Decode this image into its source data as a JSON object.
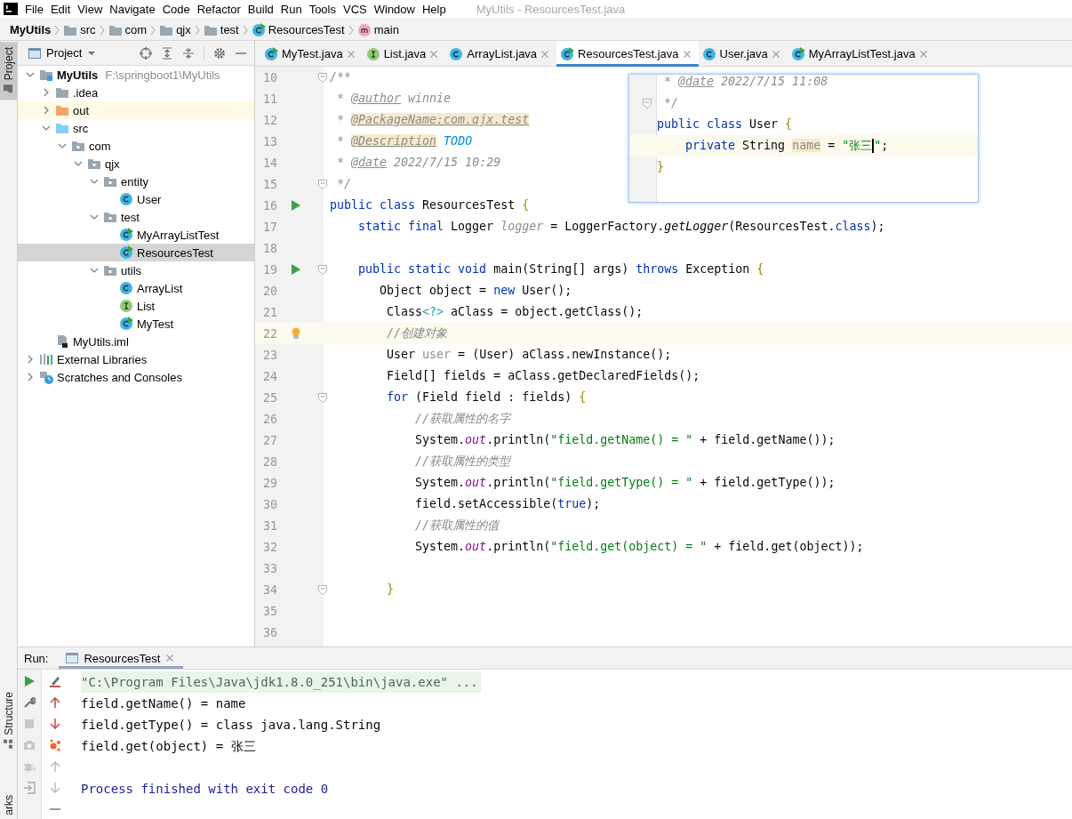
{
  "menu_bar": {
    "items": [
      "File",
      "Edit",
      "View",
      "Navigate",
      "Code",
      "Refactor",
      "Build",
      "Run",
      "Tools",
      "VCS",
      "Window",
      "Help"
    ],
    "window_title": "MyUtils - ResourcesTest.java"
  },
  "breadcrumbs": [
    {
      "label": "MyUtils",
      "kind": "project"
    },
    {
      "label": "src",
      "kind": "folder"
    },
    {
      "label": "com",
      "kind": "folder"
    },
    {
      "label": "qjx",
      "kind": "folder"
    },
    {
      "label": "test",
      "kind": "folder"
    },
    {
      "label": "ResourcesTest",
      "kind": "runnable-class"
    },
    {
      "label": "main",
      "kind": "method"
    }
  ],
  "tool_strip": [
    {
      "label": "Project",
      "selected": true,
      "kind": "top"
    },
    {
      "label": "Structure",
      "selected": false,
      "kind": "bottom"
    },
    {
      "label": "arks",
      "selected": false,
      "kind": "cut"
    }
  ],
  "project": {
    "title": "Project",
    "tree": [
      {
        "label": "MyUtils",
        "path": "F:\\springboot1\\MyUtils",
        "kind": "module",
        "expanded": true,
        "selected": false,
        "hovered": false,
        "children": [
          {
            "label": ".idea",
            "kind": "folder",
            "expanded": false,
            "selected": false,
            "hovered": false
          },
          {
            "label": "out",
            "kind": "excluded-folder",
            "expanded": false,
            "selected": false,
            "hovered": true
          },
          {
            "label": "src",
            "kind": "source-folder",
            "expanded": true,
            "selected": false,
            "hovered": false,
            "children": [
              {
                "label": "com",
                "kind": "package",
                "expanded": true,
                "selected": false,
                "hovered": false,
                "children": [
                  {
                    "label": "qjx",
                    "kind": "package",
                    "expanded": true,
                    "selected": false,
                    "hovered": false,
                    "children": [
                      {
                        "label": "entity",
                        "kind": "package",
                        "expanded": true,
                        "selected": false,
                        "hovered": false,
                        "children": [
                          {
                            "label": "User",
                            "kind": "class",
                            "selected": false,
                            "hovered": false
                          }
                        ]
                      },
                      {
                        "label": "test",
                        "kind": "package",
                        "expanded": true,
                        "selected": false,
                        "hovered": false,
                        "children": [
                          {
                            "label": "MyArrayListTest",
                            "kind": "runnable-class",
                            "selected": false,
                            "hovered": false
                          },
                          {
                            "label": "ResourcesTest",
                            "kind": "runnable-class",
                            "selected": true,
                            "hovered": false
                          }
                        ]
                      },
                      {
                        "label": "utils",
                        "kind": "package",
                        "expanded": true,
                        "selected": false,
                        "hovered": false,
                        "children": [
                          {
                            "label": "ArrayList",
                            "kind": "class",
                            "selected": false,
                            "hovered": false
                          },
                          {
                            "label": "List",
                            "kind": "interface",
                            "selected": false,
                            "hovered": false
                          },
                          {
                            "label": "MyTest",
                            "kind": "runnable-class",
                            "selected": false,
                            "hovered": false
                          }
                        ]
                      }
                    ]
                  }
                ]
              }
            ]
          },
          {
            "label": "MyUtils.iml",
            "kind": "iml",
            "selected": false,
            "hovered": false
          }
        ]
      },
      {
        "label": "External Libraries",
        "kind": "libraries",
        "expanded": false,
        "selected": false,
        "hovered": false
      },
      {
        "label": "Scratches and Consoles",
        "kind": "scratches",
        "expanded": false,
        "selected": false,
        "hovered": false
      }
    ]
  },
  "editor_tabs": [
    {
      "label": "MyTest.java",
      "kind": "runnable-class",
      "selected": false
    },
    {
      "label": "List.java",
      "kind": "interface",
      "selected": false
    },
    {
      "label": "ArrayList.java",
      "kind": "class",
      "selected": false
    },
    {
      "label": "ResourcesTest.java",
      "kind": "runnable-class",
      "selected": true
    },
    {
      "label": "User.java",
      "kind": "class",
      "selected": false
    },
    {
      "label": "MyArrayListTest.java",
      "kind": "runnable-class",
      "selected": false
    }
  ],
  "editor": {
    "lines": [
      {
        "number": "10",
        "kind": "plain",
        "fold": true,
        "current": false,
        "tokens": [
          {
            "kind": "doc",
            "text": "/**"
          }
        ]
      },
      {
        "number": "11",
        "kind": "plain",
        "fold": false,
        "current": false,
        "tokens": [
          {
            "kind": "doc",
            "text": " * "
          },
          {
            "kind": "doctag",
            "text": "@author"
          },
          {
            "kind": "doc",
            "text": " winnie"
          }
        ]
      },
      {
        "number": "12",
        "kind": "plain",
        "fold": false,
        "current": false,
        "tokens": [
          {
            "kind": "doc",
            "text": " * "
          },
          {
            "kind": "doctag-marked",
            "text": "@PackageName:com.qjx.test"
          }
        ]
      },
      {
        "number": "13",
        "kind": "plain",
        "fold": false,
        "current": false,
        "tokens": [
          {
            "kind": "doc",
            "text": " * "
          },
          {
            "kind": "doctag-marked",
            "text": "@Description"
          },
          {
            "kind": "todo",
            "text": " TODO"
          }
        ]
      },
      {
        "number": "14",
        "kind": "plain",
        "fold": false,
        "current": false,
        "tokens": [
          {
            "kind": "doc",
            "text": " * "
          },
          {
            "kind": "doctag",
            "text": "@date"
          },
          {
            "kind": "doc",
            "text": " 2022/7/15 10:29"
          }
        ]
      },
      {
        "number": "15",
        "kind": "plain",
        "fold": true,
        "current": false,
        "tokens": [
          {
            "kind": "doc",
            "text": " */"
          }
        ]
      },
      {
        "number": "16",
        "kind": "run",
        "fold": false,
        "current": false,
        "tokens": [
          {
            "kind": "kw",
            "text": "public class "
          },
          {
            "kind": "plain",
            "text": "ResourcesTest "
          },
          {
            "kind": "brace",
            "text": "{"
          }
        ]
      },
      {
        "number": "17",
        "kind": "plain",
        "fold": false,
        "current": false,
        "tokens": [
          {
            "kind": "kw",
            "text": "    static final "
          },
          {
            "kind": "plain",
            "text": "Logger "
          },
          {
            "kind": "unused-static",
            "text": "logger"
          },
          {
            "kind": "plain",
            "text": " = LoggerFactory."
          },
          {
            "kind": "static-call",
            "text": "getLogger"
          },
          {
            "kind": "plain",
            "text": "(ResourcesTest."
          },
          {
            "kind": "kw",
            "text": "class"
          },
          {
            "kind": "plain",
            "text": ");"
          }
        ]
      },
      {
        "number": "18",
        "kind": "plain",
        "fold": false,
        "current": false
      },
      {
        "number": "19",
        "kind": "run",
        "fold": true,
        "current": false,
        "tokens": [
          {
            "kind": "kw",
            "text": "    public static void "
          },
          {
            "kind": "plain",
            "text": "main(String[] args) "
          },
          {
            "kind": "kw",
            "text": "throws "
          },
          {
            "kind": "plain",
            "text": "Exception "
          },
          {
            "kind": "brace",
            "text": "{"
          }
        ]
      },
      {
        "number": "20",
        "kind": "plain",
        "fold": false,
        "current": false,
        "tokens": [
          {
            "kind": "plain",
            "text": "       Object object = "
          },
          {
            "kind": "kw",
            "text": "new "
          },
          {
            "kind": "plain",
            "text": "User();"
          }
        ]
      },
      {
        "number": "21",
        "kind": "plain",
        "fold": false,
        "current": false,
        "tokens": [
          {
            "kind": "plain",
            "text": "        Class"
          },
          {
            "kind": "generic",
            "text": "<?>"
          },
          {
            "kind": "plain",
            "text": " aClass = object.getClass();"
          }
        ]
      },
      {
        "number": "22",
        "kind": "bulb",
        "fold": false,
        "current": true,
        "tokens": [
          {
            "kind": "comment",
            "text": "        //创建对象"
          }
        ]
      },
      {
        "number": "23",
        "kind": "plain",
        "fold": false,
        "current": false,
        "tokens": [
          {
            "kind": "plain",
            "text": "        User "
          },
          {
            "kind": "unused",
            "text": "user"
          },
          {
            "kind": "plain",
            "text": " = (User) aClass.newInstance();"
          }
        ]
      },
      {
        "number": "24",
        "kind": "plain",
        "fold": false,
        "current": false,
        "tokens": [
          {
            "kind": "plain",
            "text": "        Field[] fields = aClass.getDeclaredFields();"
          }
        ]
      },
      {
        "number": "25",
        "kind": "plain",
        "fold": true,
        "current": false,
        "tokens": [
          {
            "kind": "kw",
            "text": "        for "
          },
          {
            "kind": "plain",
            "text": "(Field field : fields) "
          },
          {
            "kind": "brace",
            "text": "{"
          }
        ]
      },
      {
        "number": "26",
        "kind": "plain",
        "fold": false,
        "current": false,
        "tokens": [
          {
            "kind": "comment",
            "text": "            //获取属性的名字"
          }
        ]
      },
      {
        "number": "27",
        "kind": "plain",
        "fold": false,
        "current": false,
        "tokens": [
          {
            "kind": "plain",
            "text": "            System."
          },
          {
            "kind": "static",
            "text": "out"
          },
          {
            "kind": "plain",
            "text": ".println("
          },
          {
            "kind": "string",
            "text": "\"field.getName() = \""
          },
          {
            "kind": "plain",
            "text": " + field.getName());"
          }
        ]
      },
      {
        "number": "28",
        "kind": "plain",
        "fold": false,
        "current": false,
        "tokens": [
          {
            "kind": "comment",
            "text": "            //获取属性的类型"
          }
        ]
      },
      {
        "number": "29",
        "kind": "plain",
        "fold": false,
        "current": false,
        "tokens": [
          {
            "kind": "plain",
            "text": "            System."
          },
          {
            "kind": "static",
            "text": "out"
          },
          {
            "kind": "plain",
            "text": ".println("
          },
          {
            "kind": "string",
            "text": "\"field.getType() = \""
          },
          {
            "kind": "plain",
            "text": " + field.getType());"
          }
        ]
      },
      {
        "number": "30",
        "kind": "plain",
        "fold": false,
        "current": false,
        "tokens": [
          {
            "kind": "plain",
            "text": "            field.setAccessible("
          },
          {
            "kind": "kw",
            "text": "true"
          },
          {
            "kind": "plain",
            "text": ");"
          }
        ]
      },
      {
        "number": "31",
        "kind": "plain",
        "fold": false,
        "current": false,
        "tokens": [
          {
            "kind": "comment",
            "text": "            //获取属性的值"
          }
        ]
      },
      {
        "number": "32",
        "kind": "plain",
        "fold": false,
        "current": false,
        "tokens": [
          {
            "kind": "plain",
            "text": "            System."
          },
          {
            "kind": "static",
            "text": "out"
          },
          {
            "kind": "plain",
            "text": ".println("
          },
          {
            "kind": "string",
            "text": "\"field.get(object) = \""
          },
          {
            "kind": "plain",
            "text": " + field.get(object));"
          }
        ]
      },
      {
        "number": "33",
        "kind": "plain",
        "fold": false,
        "current": false
      },
      {
        "number": "34",
        "kind": "plain",
        "fold": true,
        "current": false,
        "tokens": [
          {
            "kind": "brace",
            "text": "        }"
          }
        ]
      },
      {
        "number": "35",
        "kind": "plain",
        "fold": false,
        "current": false
      },
      {
        "number": "36",
        "kind": "plain",
        "fold": false,
        "current": false
      }
    ],
    "popup": {
      "lines": [
        {
          "fold": false,
          "current": false,
          "tokens": [
            {
              "kind": "doc",
              "text": " * "
            },
            {
              "kind": "doctag",
              "text": "@date"
            },
            {
              "kind": "doc",
              "text": " 2022/7/15 11:08"
            }
          ]
        },
        {
          "fold": true,
          "current": false,
          "tokens": [
            {
              "kind": "doc",
              "text": " */"
            }
          ]
        },
        {
          "fold": false,
          "current": false,
          "tokens": [
            {
              "kind": "kw",
              "text": "public class "
            },
            {
              "kind": "plain",
              "text": "User "
            },
            {
              "kind": "brace",
              "text": "{"
            }
          ]
        },
        {
          "fold": false,
          "current": true,
          "tokens": [
            {
              "kind": "kw",
              "text": "    private "
            },
            {
              "kind": "plain",
              "text": "String "
            },
            {
              "kind": "field-marked",
              "text": "name"
            },
            {
              "kind": "plain",
              "text": " = "
            },
            {
              "kind": "string",
              "text": "\"张三"
            },
            {
              "kind": "caret"
            },
            {
              "kind": "string",
              "text": "\""
            },
            {
              "kind": "plain",
              "text": ";"
            }
          ]
        },
        {
          "fold": false,
          "current": false,
          "tokens": [
            {
              "kind": "brace",
              "text": "}"
            }
          ]
        }
      ]
    }
  },
  "run_panel": {
    "label": "Run:",
    "tabs": [
      {
        "label": "ResourcesTest",
        "selected": true
      }
    ],
    "console": [
      {
        "kind": "command",
        "text": "\"C:\\Program Files\\Java\\jdk1.8.0_251\\bin\\java.exe\" ..."
      },
      {
        "kind": "output",
        "text": "field.getName() = name"
      },
      {
        "kind": "output",
        "text": "field.getType() = class java.lang.String"
      },
      {
        "kind": "output",
        "text": "field.get(object) = 张三"
      },
      {
        "kind": "exit",
        "text": "Process finished with exit code 0"
      }
    ]
  }
}
